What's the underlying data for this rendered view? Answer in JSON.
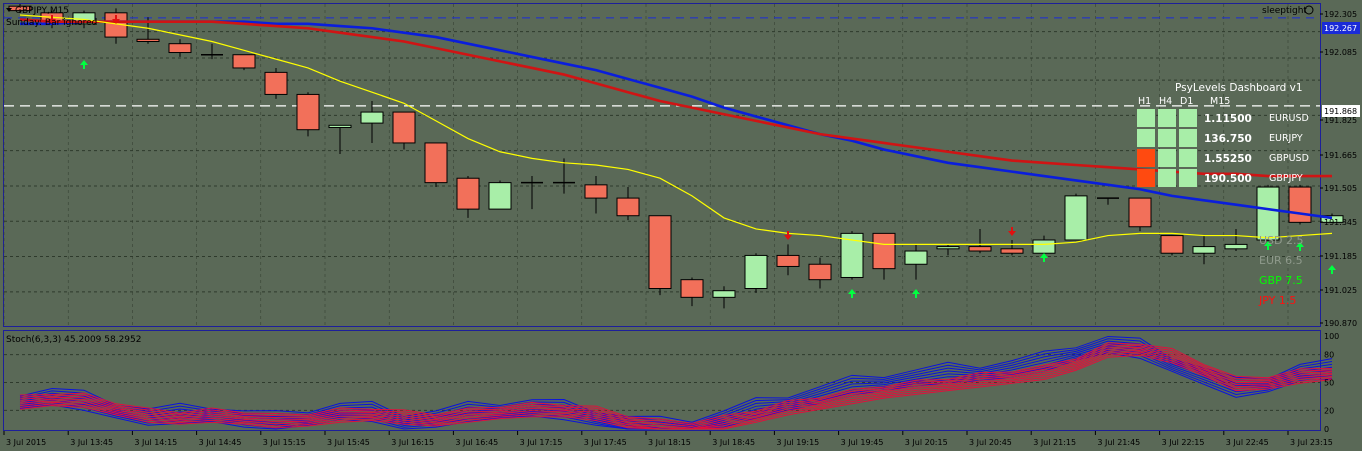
{
  "window": {
    "title": "GBPJPY,M15",
    "status_line": "Sunday: Bar ignored",
    "watermark": "sleeptight"
  },
  "colors": {
    "background": "#5a6957",
    "bull": "#a8eea8",
    "bear": "#f2705a",
    "blue_ma": "#0a1edc",
    "red_ma": "#d01414",
    "yellow_ma": "#ffff00",
    "stoch_blue": "#0a14dc",
    "stoch_red": "#e0103c"
  },
  "price_axis": {
    "ticks": [
      "192.305",
      "192.267",
      "192.085",
      "191.868",
      "191.825",
      "191.665",
      "191.505",
      "191.345",
      "191.185",
      "191.025",
      "190.870"
    ],
    "current_price_label": "192.267",
    "white_line_label": "191.868"
  },
  "stoch": {
    "title": "Stoch(6,3,3) 45.2009 58.2952",
    "levels": [
      "100",
      "80",
      "50",
      "20",
      "0"
    ]
  },
  "time_axis": [
    "3 Jul 2015",
    "3 Jul 13:45",
    "3 Jul 14:15",
    "3 Jul 14:45",
    "3 Jul 15:15",
    "3 Jul 15:45",
    "3 Jul 16:15",
    "3 Jul 16:45",
    "3 Jul 17:15",
    "3 Jul 17:45",
    "3 Jul 18:15",
    "3 Jul 18:45",
    "3 Jul 19:15",
    "3 Jul 19:45",
    "3 Jul 20:15",
    "3 Jul 20:45",
    "3 Jul 21:15",
    "3 Jul 21:45",
    "3 Jul 22:15",
    "3 Jul 22:45",
    "3 Jul 23:15"
  ],
  "dashboard": {
    "title": "PsyLevels Dashboard v1",
    "headers": [
      "H1",
      "H4",
      "D1",
      "M15"
    ],
    "rows": [
      {
        "price": "1.11500",
        "symbol": "EURUSD",
        "cells": [
          "green",
          "green",
          "green"
        ]
      },
      {
        "price": "136.750",
        "symbol": "EURJPY",
        "cells": [
          "green",
          "green",
          "green"
        ]
      },
      {
        "price": "1.55250",
        "symbol": "GBPUSD",
        "cells": [
          "red",
          "green",
          "green"
        ]
      },
      {
        "price": "190.500",
        "symbol": "GBPJPY",
        "cells": [
          "red",
          "green",
          "green"
        ]
      }
    ]
  },
  "currency_strength": [
    {
      "label": "USD  2.5",
      "color": "#8f9a8c"
    },
    {
      "label": "EUR  6.5",
      "color": "#8f9a8c"
    },
    {
      "label": "GBP  7.5",
      "color": "#00ff00"
    },
    {
      "label": "JPY  1.5",
      "color": "#ff1010"
    }
  ],
  "chart_data": {
    "type": "candlestick",
    "symbol": "GBPJPY",
    "timeframe": "M15",
    "ylim": [
      190.87,
      192.33
    ],
    "candles": [
      {
        "o": 192.32,
        "h": 192.33,
        "l": 192.29,
        "c": 192.3
      },
      {
        "o": 192.29,
        "h": 192.3,
        "l": 192.22,
        "c": 192.24
      },
      {
        "o": 192.24,
        "h": 192.3,
        "l": 192.22,
        "c": 192.29
      },
      {
        "o": 192.29,
        "h": 192.31,
        "l": 192.15,
        "c": 192.18
      },
      {
        "o": 192.17,
        "h": 192.27,
        "l": 192.15,
        "c": 192.16
      },
      {
        "o": 192.15,
        "h": 192.17,
        "l": 192.09,
        "c": 192.11
      },
      {
        "o": 192.1,
        "h": 192.15,
        "l": 192.08,
        "c": 192.1
      },
      {
        "o": 192.1,
        "h": 192.1,
        "l": 192.03,
        "c": 192.04
      },
      {
        "o": 192.02,
        "h": 192.04,
        "l": 191.9,
        "c": 191.92
      },
      {
        "o": 191.92,
        "h": 191.93,
        "l": 191.73,
        "c": 191.76
      },
      {
        "o": 191.77,
        "h": 191.78,
        "l": 191.65,
        "c": 191.78
      },
      {
        "o": 191.79,
        "h": 191.89,
        "l": 191.7,
        "c": 191.84
      },
      {
        "o": 191.84,
        "h": 191.84,
        "l": 191.67,
        "c": 191.7
      },
      {
        "o": 191.7,
        "h": 191.7,
        "l": 191.5,
        "c": 191.52
      },
      {
        "o": 191.54,
        "h": 191.55,
        "l": 191.36,
        "c": 191.4
      },
      {
        "o": 191.4,
        "h": 191.53,
        "l": 191.4,
        "c": 191.52
      },
      {
        "o": 191.52,
        "h": 191.55,
        "l": 191.4,
        "c": 191.52
      },
      {
        "o": 191.52,
        "h": 191.63,
        "l": 191.47,
        "c": 191.52
      },
      {
        "o": 191.51,
        "h": 191.55,
        "l": 191.38,
        "c": 191.45
      },
      {
        "o": 191.45,
        "h": 191.5,
        "l": 191.35,
        "c": 191.37
      },
      {
        "o": 191.37,
        "h": 191.37,
        "l": 191.01,
        "c": 191.04
      },
      {
        "o": 191.08,
        "h": 191.09,
        "l": 190.96,
        "c": 191.0
      },
      {
        "o": 191.0,
        "h": 191.05,
        "l": 190.95,
        "c": 191.03
      },
      {
        "o": 191.04,
        "h": 191.2,
        "l": 191.02,
        "c": 191.19
      },
      {
        "o": 191.19,
        "h": 191.24,
        "l": 191.1,
        "c": 191.14
      },
      {
        "o": 191.15,
        "h": 191.18,
        "l": 191.04,
        "c": 191.08
      },
      {
        "o": 191.09,
        "h": 191.3,
        "l": 191.08,
        "c": 191.29
      },
      {
        "o": 191.29,
        "h": 191.29,
        "l": 191.08,
        "c": 191.13
      },
      {
        "o": 191.15,
        "h": 191.24,
        "l": 191.08,
        "c": 191.21
      },
      {
        "o": 191.22,
        "h": 191.24,
        "l": 191.19,
        "c": 191.23
      },
      {
        "o": 191.23,
        "h": 191.31,
        "l": 191.2,
        "c": 191.21
      },
      {
        "o": 191.22,
        "h": 191.26,
        "l": 191.19,
        "c": 191.2
      },
      {
        "o": 191.2,
        "h": 191.28,
        "l": 191.19,
        "c": 191.26
      },
      {
        "o": 191.26,
        "h": 191.47,
        "l": 191.26,
        "c": 191.46
      },
      {
        "o": 191.45,
        "h": 191.45,
        "l": 191.42,
        "c": 191.45
      },
      {
        "o": 191.45,
        "h": 191.45,
        "l": 191.3,
        "c": 191.32
      },
      {
        "o": 191.28,
        "h": 191.28,
        "l": 191.19,
        "c": 191.2
      },
      {
        "o": 191.2,
        "h": 191.28,
        "l": 191.15,
        "c": 191.23
      },
      {
        "o": 191.22,
        "h": 191.31,
        "l": 191.21,
        "c": 191.24
      },
      {
        "o": 191.26,
        "h": 191.51,
        "l": 191.25,
        "c": 191.5
      },
      {
        "o": 191.5,
        "h": 191.51,
        "l": 191.33,
        "c": 191.34
      },
      {
        "o": 191.34,
        "h": 191.38,
        "l": 191.34,
        "c": 191.37
      }
    ],
    "series": [
      {
        "name": "blue_ma",
        "color": "#0a1edc",
        "values": [
          192.24,
          192.24,
          192.25,
          192.25,
          192.25,
          192.25,
          192.25,
          192.25,
          192.24,
          192.24,
          192.23,
          192.22,
          192.2,
          192.18,
          192.15,
          192.12,
          192.09,
          192.06,
          192.03,
          191.99,
          191.95,
          191.91,
          191.86,
          191.82,
          191.78,
          191.74,
          191.71,
          191.67,
          191.64,
          191.61,
          191.59,
          191.57,
          191.55,
          191.53,
          191.51,
          191.49,
          191.46,
          191.44,
          191.42,
          191.4,
          191.38,
          191.36
        ]
      },
      {
        "name": "red_ma",
        "color": "#d01414",
        "values": [
          192.26,
          192.25,
          192.25,
          192.25,
          192.25,
          192.25,
          192.25,
          192.24,
          192.23,
          192.22,
          192.2,
          192.18,
          192.16,
          192.13,
          192.1,
          192.07,
          192.04,
          192.01,
          191.97,
          191.93,
          191.89,
          191.86,
          191.83,
          191.8,
          191.77,
          191.74,
          191.72,
          191.7,
          191.68,
          191.66,
          191.64,
          191.62,
          191.61,
          191.6,
          191.59,
          191.58,
          191.57,
          191.56,
          191.56,
          191.55,
          191.55,
          191.55
        ]
      },
      {
        "name": "yellow_ma",
        "color": "#ffff00",
        "values": [
          192.28,
          192.27,
          192.26,
          192.24,
          192.22,
          192.19,
          192.16,
          192.12,
          192.08,
          192.04,
          191.98,
          191.93,
          191.88,
          191.8,
          191.72,
          191.66,
          191.63,
          191.61,
          191.6,
          191.58,
          191.54,
          191.46,
          191.36,
          191.31,
          191.29,
          191.28,
          191.26,
          191.24,
          191.24,
          191.24,
          191.24,
          191.24,
          191.24,
          191.25,
          191.28,
          191.29,
          191.29,
          191.28,
          191.28,
          191.27,
          191.28,
          191.29
        ]
      }
    ]
  }
}
